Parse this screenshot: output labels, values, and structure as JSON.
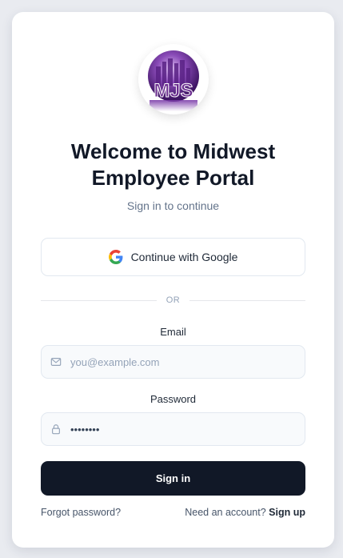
{
  "logo": {
    "text": "MJS"
  },
  "header": {
    "title_line1": "Welcome to Midwest",
    "title_line2": "Employee Portal",
    "subtitle": "Sign in to continue"
  },
  "google": {
    "label": "Continue with Google"
  },
  "divider": {
    "text": "OR"
  },
  "email": {
    "label": "Email",
    "placeholder": "you@example.com",
    "icon": "mail-icon"
  },
  "password": {
    "label": "Password",
    "value": "secret12",
    "icon": "lock-icon"
  },
  "signin": {
    "label": "Sign in"
  },
  "footer": {
    "forgot": "Forgot password?",
    "prompt": "Need an account?",
    "signup": "Sign up"
  },
  "colors": {
    "primary_button": "#111827",
    "logo_purple": "#6b2d8f"
  }
}
